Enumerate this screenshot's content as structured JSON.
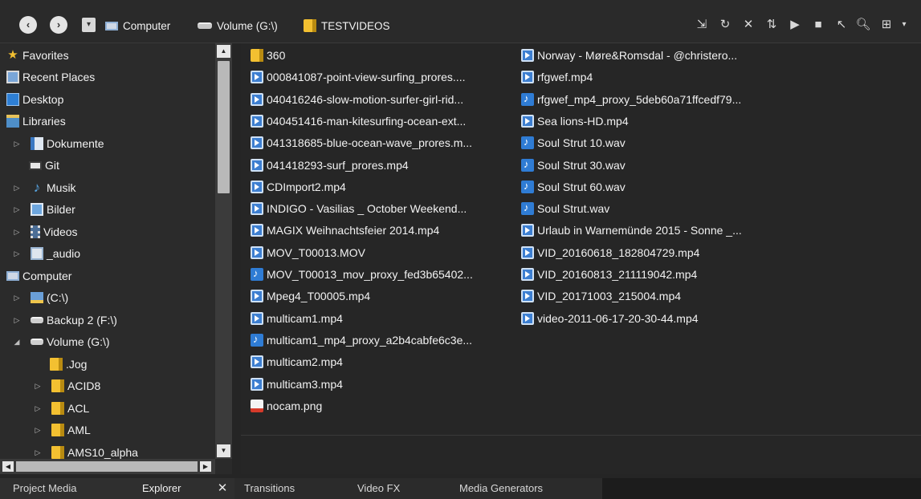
{
  "toolbar": {
    "back_glyph": "‹",
    "forward_glyph": "›",
    "dropdown_glyph": "▾",
    "breadcrumbs": [
      "Computer",
      "Volume (G:\\)",
      "TESTVIDEOS"
    ],
    "icons": [
      "import-icon",
      "refresh-icon",
      "delete-icon",
      "move-up-icon",
      "play-icon",
      "stop-icon",
      "auto-preview-icon",
      "search-icon",
      "views-icon"
    ],
    "icon_glyphs": [
      "⇲",
      "↻",
      "✕",
      "⇅",
      "▶",
      "■",
      "↖",
      "🔍︎",
      "⊞"
    ]
  },
  "tree": {
    "items": [
      {
        "label": "Favorites",
        "icon": "star-icon",
        "expander": ""
      },
      {
        "label": "Recent Places",
        "icon": "recent-places-icon",
        "expander": ""
      },
      {
        "label": "Desktop",
        "icon": "desktop-icon",
        "expander": ""
      },
      {
        "label": "Libraries",
        "icon": "libraries-icon",
        "expander": ""
      },
      {
        "label": "Dokumente",
        "icon": "documents-icon",
        "expander": "▷"
      },
      {
        "label": "Git",
        "icon": "git-icon",
        "expander": ""
      },
      {
        "label": "Musik",
        "icon": "music-icon",
        "expander": "▷"
      },
      {
        "label": "Bilder",
        "icon": "pictures-icon",
        "expander": "▷"
      },
      {
        "label": "Videos",
        "icon": "videos-icon",
        "expander": "▷"
      },
      {
        "label": "_audio",
        "icon": "audio-folder-icon",
        "expander": "▷"
      },
      {
        "label": "Computer",
        "icon": "computer-icon",
        "expander": ""
      },
      {
        "label": "(C:\\)",
        "icon": "c-drive-icon",
        "expander": "▷"
      },
      {
        "label": "Backup 2 (F:\\)",
        "icon": "drive-icon",
        "expander": "▷"
      },
      {
        "label": "Volume (G:\\)",
        "icon": "drive-icon",
        "expander": "◢"
      },
      {
        "label": ".Jog",
        "icon": "folder-icon",
        "expander": ""
      },
      {
        "label": "ACID8",
        "icon": "folder-icon",
        "expander": "▷"
      },
      {
        "label": "ACL",
        "icon": "folder-icon",
        "expander": "▷"
      },
      {
        "label": "AML",
        "icon": "folder-icon",
        "expander": "▷"
      },
      {
        "label": "AMS10_alpha",
        "icon": "folder-icon",
        "expander": "▷"
      }
    ]
  },
  "files": {
    "column1": [
      {
        "name": "360",
        "type": "folder"
      },
      {
        "name": "000841087-point-view-surfing_prores....",
        "type": "video"
      },
      {
        "name": "040416246-slow-motion-surfer-girl-rid...",
        "type": "video"
      },
      {
        "name": "040451416-man-kitesurfing-ocean-ext...",
        "type": "video"
      },
      {
        "name": "041318685-blue-ocean-wave_prores.m...",
        "type": "video"
      },
      {
        "name": "041418293-surf_prores.mp4",
        "type": "video"
      },
      {
        "name": "CDImport2.mp4",
        "type": "video"
      },
      {
        "name": "INDIGO - Vasilias _ October Weekend...",
        "type": "video"
      },
      {
        "name": "MAGIX Weihnachtsfeier 2014.mp4",
        "type": "video"
      },
      {
        "name": "MOV_T00013.MOV",
        "type": "video"
      },
      {
        "name": "MOV_T00013_mov_proxy_fed3b65402...",
        "type": "audio"
      },
      {
        "name": "Mpeg4_T00005.mp4",
        "type": "video"
      },
      {
        "name": "multicam1.mp4",
        "type": "video"
      },
      {
        "name": "multicam1_mp4_proxy_a2b4cabfe6c3e...",
        "type": "audio"
      },
      {
        "name": "multicam2.mp4",
        "type": "video"
      },
      {
        "name": "multicam3.mp4",
        "type": "video"
      },
      {
        "name": "nocam.png",
        "type": "png"
      }
    ],
    "column2": [
      {
        "name": "Norway - Møre&Romsdal - @christero...",
        "type": "video"
      },
      {
        "name": "rfgwef.mp4",
        "type": "video"
      },
      {
        "name": "rfgwef_mp4_proxy_5deb60a71ffcedf79...",
        "type": "audio"
      },
      {
        "name": "Sea lions-HD.mp4",
        "type": "video"
      },
      {
        "name": "Soul Strut 10.wav",
        "type": "audio"
      },
      {
        "name": "Soul Strut 30.wav",
        "type": "audio"
      },
      {
        "name": "Soul Strut 60.wav",
        "type": "audio"
      },
      {
        "name": "Soul Strut.wav",
        "type": "audio"
      },
      {
        "name": "Urlaub in Warnemünde 2015 - Sonne _...",
        "type": "video"
      },
      {
        "name": "VID_20160618_182804729.mp4",
        "type": "video"
      },
      {
        "name": "VID_20160813_211119042.mp4",
        "type": "video"
      },
      {
        "name": "VID_20171003_215004.mp4",
        "type": "video"
      },
      {
        "name": "video-2011-06-17-20-30-44.mp4",
        "type": "video"
      }
    ]
  },
  "tabs": {
    "items": [
      "Project Media",
      "Explorer",
      "Transitions",
      "Video FX",
      "Media Generators"
    ],
    "close_glyph": "✕"
  },
  "scroll": {
    "up": "▲",
    "down": "▼",
    "left": "◀",
    "right": "▶"
  }
}
